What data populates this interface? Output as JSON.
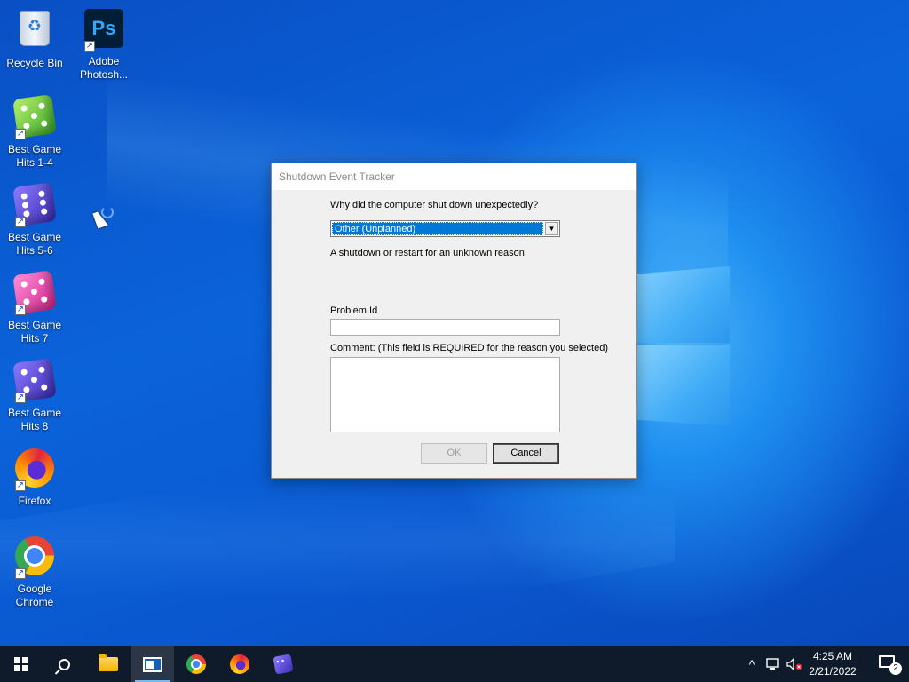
{
  "desktop": {
    "icons": [
      {
        "label": "Recycle Bin",
        "icon": "recycle-bin-icon"
      },
      {
        "label": "Adobe Photosh...",
        "icon": "photoshop-icon",
        "glyph": "Ps"
      },
      {
        "label": "Best Game Hits 1-4",
        "icon": "green-dice-icon"
      },
      {
        "label": "Best Game Hits 5-6",
        "icon": "purple-dice-icon"
      },
      {
        "label": "Best Game Hits 7",
        "icon": "pink-dice-icon"
      },
      {
        "label": "Best Game Hits 8",
        "icon": "purple-dice-icon"
      },
      {
        "label": "Firefox",
        "icon": "firefox-icon"
      },
      {
        "label": "Google Chrome",
        "icon": "chrome-icon"
      }
    ],
    "shortcut_glyph": "↗"
  },
  "dialog": {
    "title": "Shutdown Event Tracker",
    "question": "Why did the computer shut down unexpectedly?",
    "reason_selected": "Other (Unplanned)",
    "reason_description": "A shutdown or restart for an unknown reason",
    "problem_id_label": "Problem Id",
    "problem_id_value": "",
    "comment_label": "Comment: (This field is REQUIRED for the reason you selected)",
    "comment_value": "",
    "ok_label": "OK",
    "cancel_label": "Cancel",
    "dropdown_glyph": "▼"
  },
  "taskbar": {
    "time": "4:25 AM",
    "date": "2/21/2022",
    "notification_count": "2",
    "tray_chevron": "^",
    "apps": [
      "start",
      "search",
      "file-explorer",
      "active-app",
      "chrome",
      "firefox",
      "game-dice"
    ]
  },
  "colors": {
    "selection": "#0078d7",
    "taskbar": "#0f1b2b",
    "desktop": "#0b63da"
  }
}
